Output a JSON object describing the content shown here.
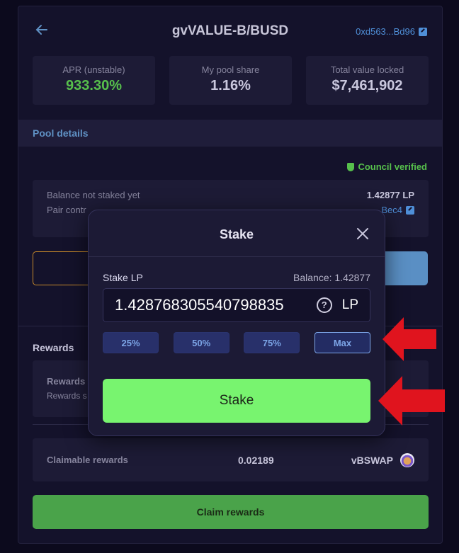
{
  "header": {
    "title": "gvVALUE-B/BUSD",
    "address": "0xd563...Bd96"
  },
  "stats": [
    {
      "label": "APR (unstable)",
      "value": "933.30%"
    },
    {
      "label": "My pool share",
      "value": "1.16%"
    },
    {
      "label": "Total value locked",
      "value": "$7,461,902"
    }
  ],
  "pool_details": {
    "title": "Pool details",
    "verified": "Council verified",
    "balance_label": "Balance not staked yet",
    "balance_value": "1.42877 LP",
    "pair_label": "Pair contr",
    "pair_value": "Bec4"
  },
  "rewards": {
    "title": "Rewards",
    "line1": "Rewards",
    "line2": "Rewards s",
    "claimable_label": "Claimable rewards",
    "claimable_value": "0.02189",
    "claimable_token": "vBSWAP",
    "claim_button": "Claim rewards"
  },
  "modal": {
    "title": "Stake",
    "input_label": "Stake LP",
    "balance": "Balance: 1.42877",
    "input_value": "1.428768305540798835",
    "unit": "LP",
    "percent_buttons": [
      "25%",
      "50%",
      "75%",
      "Max"
    ],
    "stake_button": "Stake"
  },
  "colors": {
    "accent_green": "#78f46f",
    "apr_green": "#57c04c",
    "link_blue": "#4f8fd8",
    "arrow_red": "#e0141e"
  }
}
